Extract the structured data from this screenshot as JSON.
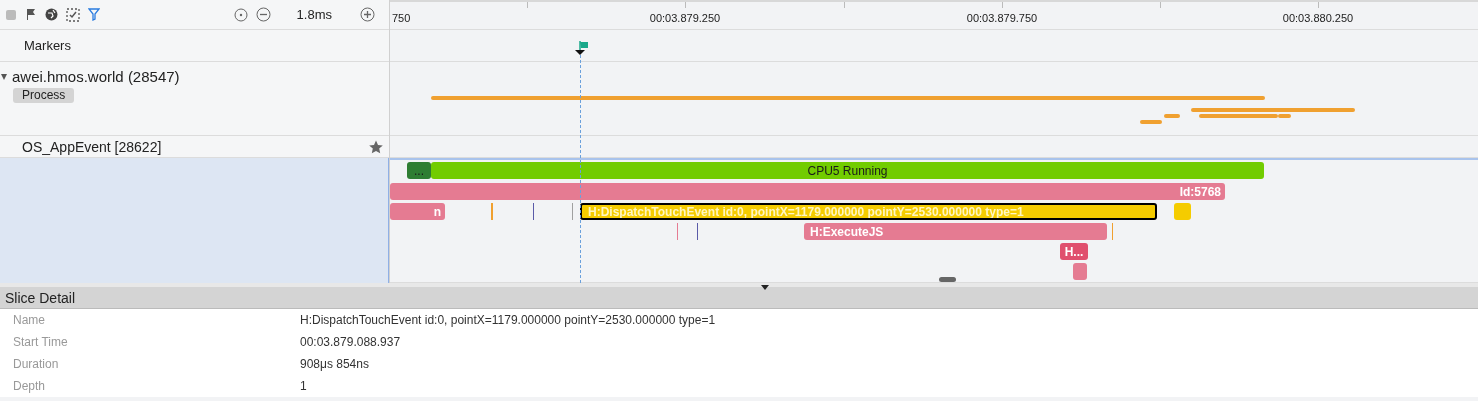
{
  "toolbar": {
    "zoom_label": "1.8ms"
  },
  "ruler": {
    "labels": [
      "750",
      "00:03.879.250",
      "00:03.879.750",
      "00:03.880.250"
    ]
  },
  "tracks": [
    {
      "kind": "markers",
      "title": "Markers"
    },
    {
      "kind": "process",
      "title": "awei.hmos.world (28547)",
      "tag": "Process",
      "expanded": true
    },
    {
      "kind": "thread",
      "title": "OS_AppEvent [28622]",
      "starred": true
    }
  ],
  "slices": [
    {
      "kind": "state",
      "label": "...",
      "color": "#2e7d32"
    },
    {
      "kind": "state",
      "label": "CPU5 Running",
      "color": "#72cc00"
    },
    {
      "kind": "slice",
      "label": "Id:5768",
      "color": "#e57b92",
      "selected": false
    },
    {
      "kind": "slice",
      "label": "n",
      "color": "#e57b92",
      "selected": false
    },
    {
      "kind": "tick",
      "color": "#f0a030"
    },
    {
      "kind": "tick",
      "color": "#5a5aa8"
    },
    {
      "kind": "tick",
      "color": "#a0a0a0"
    },
    {
      "kind": "slice",
      "label": "H:DispatchTouchEvent id:0, pointX=1179.000000 pointY=2530.000000 type=1",
      "color": "#f5cc00",
      "selected": true
    },
    {
      "kind": "slice",
      "color": "#f5cc00",
      "selected": false
    },
    {
      "kind": "tick",
      "color": "#e57b92"
    },
    {
      "kind": "tick",
      "color": "#5a5aa8"
    },
    {
      "kind": "slice",
      "label": "H:ExecuteJS",
      "color": "#e57b92",
      "selected": false
    },
    {
      "kind": "tick",
      "color": "#f0a030"
    },
    {
      "kind": "slice",
      "label": "H...",
      "color": "#e0506e",
      "selected": false
    },
    {
      "kind": "slice",
      "color": "#e57b92",
      "selected": false
    }
  ],
  "detail": {
    "title": "Slice Detail",
    "rows": [
      {
        "label": "Name",
        "value": "H:DispatchTouchEvent id:0, pointX=1179.000000 pointY=2530.000000 type=1"
      },
      {
        "label": "Start Time",
        "value": "00:03.879.088.937"
      },
      {
        "label": "Duration",
        "value": "908μs 854ns"
      },
      {
        "label": "Depth",
        "value": "1"
      }
    ]
  }
}
